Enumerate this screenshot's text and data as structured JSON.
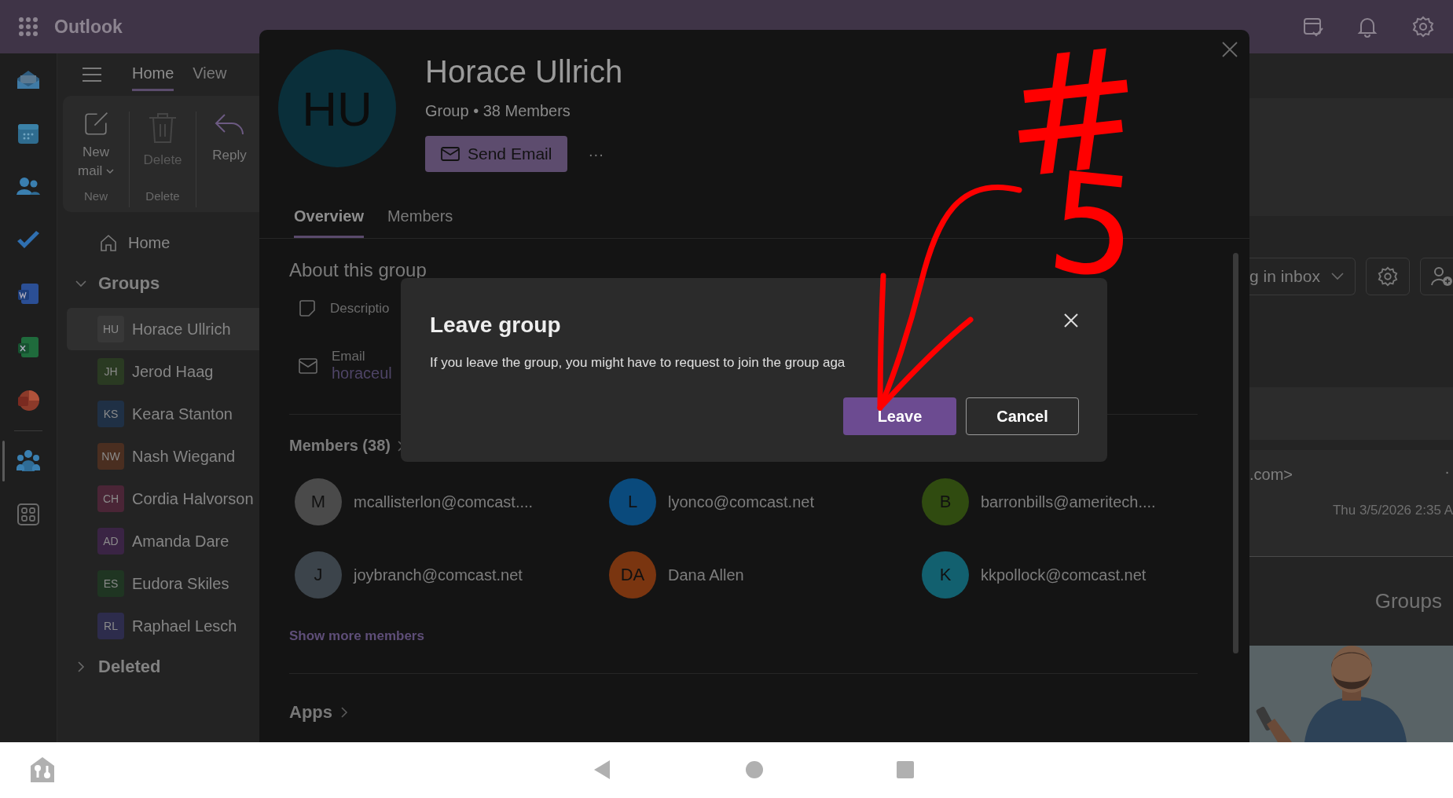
{
  "top_bar": {
    "app_name": "Outlook"
  },
  "app_rail": {
    "items": [
      {
        "kind": "mail",
        "selected": false
      },
      {
        "kind": "calendar",
        "selected": false
      },
      {
        "kind": "people",
        "selected": false
      },
      {
        "kind": "todo",
        "selected": false
      },
      {
        "kind": "word",
        "selected": false
      },
      {
        "kind": "excel",
        "selected": false
      },
      {
        "kind": "powerpoint",
        "selected": false
      },
      {
        "kind": "groups",
        "selected": true
      },
      {
        "kind": "apps",
        "selected": false
      }
    ]
  },
  "ribbon": {
    "tabs": [
      {
        "label": "Home",
        "selected": true
      },
      {
        "label": "View",
        "selected": false
      }
    ],
    "groups": [
      {
        "label": "New",
        "buttons": [
          {
            "kind": "new-mail",
            "label": "New mail",
            "disabled": false,
            "has_menu": true
          }
        ]
      },
      {
        "label": "Delete",
        "buttons": [
          {
            "kind": "delete",
            "label": "Delete",
            "disabled": true,
            "has_menu": false
          }
        ]
      },
      {
        "buttons": [
          {
            "kind": "reply",
            "label": "Reply",
            "disabled": false,
            "has_menu": false
          }
        ]
      }
    ]
  },
  "nav": {
    "home": "Home",
    "folders": [
      {
        "label": "Groups",
        "expanded": true,
        "children": [
          {
            "initials": "HU",
            "name": "Horace Ullrich",
            "color": "#383838",
            "selected": true
          },
          {
            "initials": "JH",
            "name": "Jerod Haag",
            "color": "#2a3a22",
            "selected": false
          },
          {
            "initials": "KS",
            "name": "Keara Stanton",
            "color": "#1f3045",
            "selected": false
          },
          {
            "initials": "NW",
            "name": "Nash Wiegand",
            "color": "#4a2e20",
            "selected": false
          },
          {
            "initials": "CH",
            "name": "Cordia Halvorson",
            "color": "#4a2536",
            "selected": false
          },
          {
            "initials": "AD",
            "name": "Amanda Dare",
            "color": "#3a2444",
            "selected": false
          },
          {
            "initials": "ES",
            "name": "Eudora Skiles",
            "color": "#1f3522",
            "selected": false
          },
          {
            "initials": "RL",
            "name": "Raphael Lesch",
            "color": "#2d2c4c",
            "selected": false
          }
        ]
      },
      {
        "label": "Deleted",
        "expanded": false
      }
    ]
  },
  "main_view": {
    "filter_dropdown": "g in inbox",
    "sender": ".com>",
    "more": "·",
    "date": "Thu 3/5/2026 2:35 A",
    "groups_heading": "Groups"
  },
  "group_panel": {
    "avatar_initials": "HU",
    "title": "Horace Ullrich",
    "subtitle": "Group • 38 Members",
    "send_button": "Send Email",
    "more_button": "···",
    "tabs": [
      {
        "label": "Overview",
        "selected": true
      },
      {
        "label": "Members",
        "selected": false
      }
    ],
    "about": {
      "heading": "About this group",
      "description_label": "Descriptio",
      "email_label": "Email",
      "email_value": "horaceul"
    },
    "members": {
      "heading": "Members (38)",
      "items": [
        {
          "initials": "M",
          "name": "mcallisterlon@comcast....",
          "color": "#4a4a4a"
        },
        {
          "initials": "L",
          "name": "lyonco@comcast.net",
          "color": "#0a4a7c"
        },
        {
          "initials": "B",
          "name": "barronbills@ameritech....",
          "color": "#304b10"
        },
        {
          "initials": "J",
          "name": "joybranch@comcast.net",
          "color": "#3c444b"
        },
        {
          "initials": "DA",
          "name": "Dana Allen",
          "color": "#7a3510"
        },
        {
          "initials": "K",
          "name": "kkpollock@comcast.net",
          "color": "#12606f"
        }
      ],
      "show_more": "Show more members"
    },
    "apps": {
      "heading": "Apps"
    }
  },
  "dialog": {
    "title": "Leave group",
    "message": "If you leave the group, you might have to request to join the group aga",
    "buttons": [
      {
        "label": "Leave",
        "kind": "primary"
      },
      {
        "label": "Cancel",
        "kind": "secondary"
      }
    ]
  },
  "annotation": {
    "mark": "#",
    "number": "5"
  }
}
